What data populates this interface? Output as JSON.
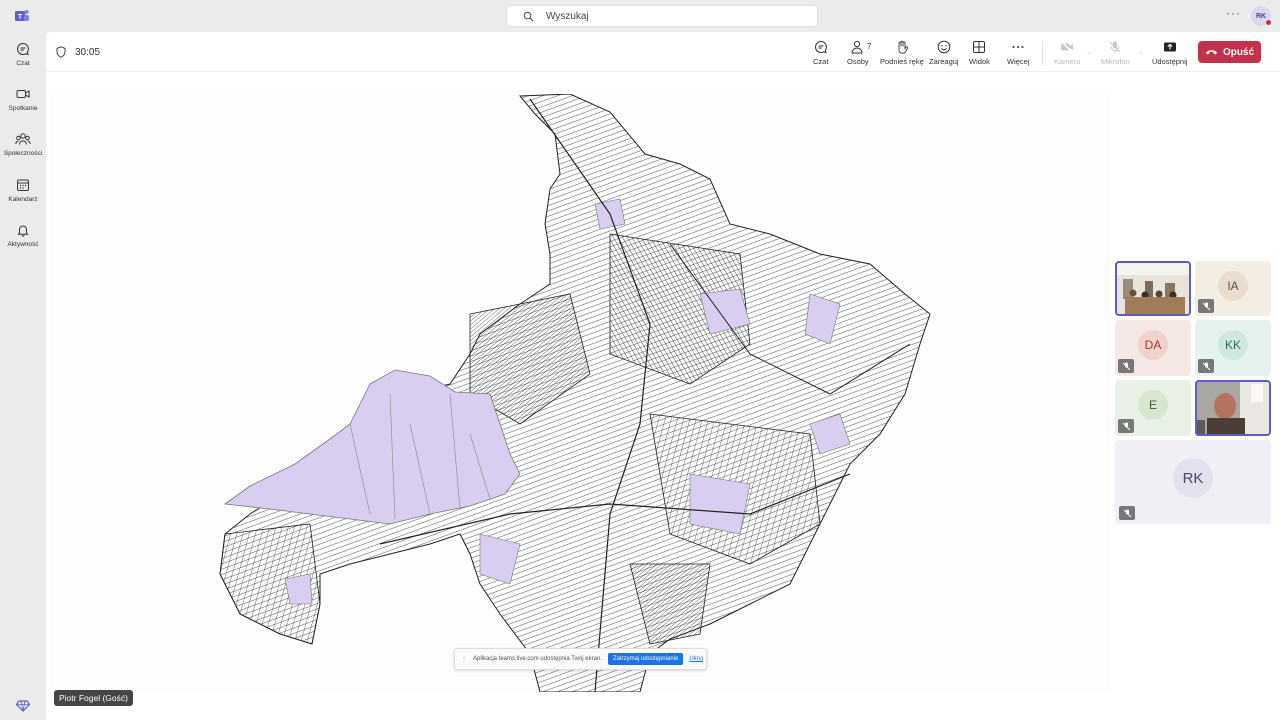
{
  "search": {
    "placeholder": "Wyszukaj"
  },
  "me": {
    "initials": "RK"
  },
  "rail": [
    {
      "label": "Czat",
      "icon": "chat-icon"
    },
    {
      "label": "Spotkanie",
      "icon": "video-icon"
    },
    {
      "label": "Społeczności",
      "icon": "communities-icon"
    },
    {
      "label": "Kalendarz",
      "icon": "calendar-icon"
    },
    {
      "label": "Aktywność",
      "icon": "bell-icon"
    }
  ],
  "meeting": {
    "timer": "30:05",
    "toolbar": {
      "chat": "Czat",
      "people": "Osoby",
      "people_count": "7",
      "raise_hand": "Podnieś rękę",
      "react": "Zareaguj",
      "view": "Widok",
      "more": "Więcej",
      "camera": "Kamera",
      "mic": "Mikrofon",
      "share": "Udostępnij",
      "leave": "Opuść"
    },
    "presenter": "Piotr Fogel (Gość)",
    "share_notice": {
      "text": "Aplikacja teams.live.com udostępnia Twój ekran.",
      "stop": "Zatrzymaj udostępnianie",
      "hide": "Ukryj"
    },
    "participants": [
      {
        "type": "video",
        "scene": "room"
      },
      {
        "initials": "IA",
        "muted": true,
        "bg": "#f3ede4",
        "fg": "#5c4d3d"
      },
      {
        "initials": "DA",
        "muted": true,
        "bg": "#f5e8e4",
        "fg": "#a13a3a"
      },
      {
        "initials": "KK",
        "muted": true,
        "bg": "#e6f2ef",
        "fg": "#2f6d61"
      },
      {
        "initials": "E",
        "muted": true,
        "bg": "#e9f1e6",
        "fg": "#3e5d36"
      },
      {
        "type": "video",
        "scene": "person"
      },
      {
        "initials": "RK",
        "muted": true,
        "bg": "#f0eff5",
        "fg": "#4b4a6b"
      }
    ]
  },
  "colors": {
    "accent": "#5b5fc7",
    "leave": "#c4314b",
    "parcel_fill": "#d9ceef"
  }
}
